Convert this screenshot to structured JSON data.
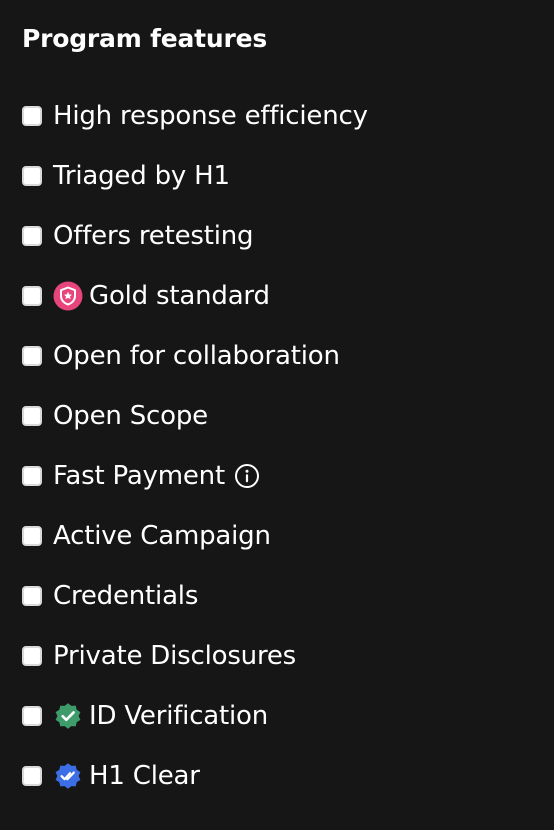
{
  "section": {
    "title": "Program features"
  },
  "features": [
    {
      "label": "High response efficiency",
      "checked": false
    },
    {
      "label": "Triaged by H1",
      "checked": false
    },
    {
      "label": "Offers retesting",
      "checked": false
    },
    {
      "label": "Gold standard",
      "checked": false,
      "icon": "gold-standard-shield-icon"
    },
    {
      "label": "Open for collaboration",
      "checked": false
    },
    {
      "label": "Open Scope",
      "checked": false
    },
    {
      "label": "Fast Payment",
      "checked": false,
      "icon": "info-icon"
    },
    {
      "label": "Active Campaign",
      "checked": false
    },
    {
      "label": "Credentials",
      "checked": false
    },
    {
      "label": "Private Disclosures",
      "checked": false
    },
    {
      "label": "ID Verification",
      "checked": false,
      "icon": "id-verification-check-badge-icon"
    },
    {
      "label": "H1 Clear",
      "checked": false,
      "icon": "h1-clear-check-badge-icon"
    }
  ],
  "colors": {
    "background": "#161616",
    "text": "#ffffff",
    "gold_standard_badge": "#e8457c",
    "id_verification_badge": "#3e9b6a",
    "h1_clear_badge": "#3c6ee6"
  }
}
